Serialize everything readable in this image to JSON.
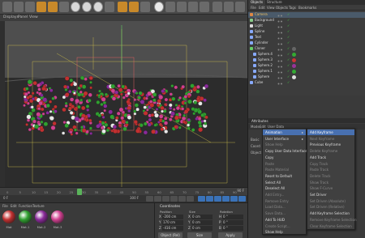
{
  "viewport_menu": [
    "Displays",
    "Panel",
    "View"
  ],
  "objects_panel": {
    "tabs": [
      "Objects",
      "Structure"
    ],
    "menu": [
      "File",
      "Edit",
      "View",
      "Objects",
      "Tags",
      "Bookmarks"
    ],
    "rows": [
      {
        "name": "Camera",
        "color": "#d84"
      },
      {
        "name": "Background",
        "color": "#8c8"
      },
      {
        "name": "Light",
        "color": "#ddd"
      },
      {
        "name": "Spline",
        "color": "#8af"
      },
      {
        "name": "Text",
        "color": "#8af"
      },
      {
        "name": "Cylinder",
        "color": "#8af"
      },
      {
        "name": "Cloner",
        "color": "#6c6"
      },
      {
        "name": "Sphere.4",
        "color": "#8af"
      },
      {
        "name": "Sphere.3",
        "color": "#8af"
      },
      {
        "name": "Sphere.2",
        "color": "#8af"
      },
      {
        "name": "Sphere.1",
        "color": "#8af"
      },
      {
        "name": "Sphere",
        "color": "#8af"
      },
      {
        "name": "Cube",
        "color": "#8af"
      }
    ]
  },
  "attributes_panel": {
    "title": "Attributes",
    "menu": [
      "Mode",
      "Edit",
      "User Data"
    ],
    "rows": [
      "Basic",
      "Coord",
      "Object"
    ]
  },
  "context_menu": {
    "items": [
      {
        "label": "Animation",
        "submenu": true,
        "highlighted": true
      },
      {
        "label": "User Interface",
        "submenu": true
      },
      {
        "label": "Show Help",
        "disabled": true
      },
      {
        "label": "Copy User Data Interface"
      },
      {
        "label": "Copy"
      },
      {
        "label": "Paste",
        "disabled": true
      },
      {
        "label": "Paste Material",
        "disabled": true
      },
      {
        "label": "Reset to Default"
      },
      {
        "label": "Select All"
      },
      {
        "label": "Deselect All"
      },
      {
        "label": "Add Entry...",
        "disabled": true
      },
      {
        "label": "Remove Entry",
        "disabled": true
      },
      {
        "label": "Load Data...",
        "disabled": true
      },
      {
        "label": "Save Data...",
        "disabled": true
      },
      {
        "label": "Add To HUD"
      },
      {
        "label": "Create Script...",
        "disabled": true
      },
      {
        "label": "Show Help"
      }
    ]
  },
  "submenu": {
    "items": [
      {
        "label": "Add Keyframe",
        "highlighted": true
      },
      {
        "label": "Next Keyframe",
        "disabled": true
      },
      {
        "label": "Previous Keyframe"
      },
      {
        "label": "Delete Keyframe",
        "disabled": true
      },
      {
        "label": "Add Track"
      },
      {
        "label": "Copy Track",
        "disabled": true
      },
      {
        "label": "Paste Track",
        "disabled": true
      },
      {
        "label": "Delete Track",
        "disabled": true
      },
      {
        "label": "Show Track",
        "disabled": true
      },
      {
        "label": "Show F-Curve",
        "disabled": true
      },
      {
        "label": "Set Driver"
      },
      {
        "label": "Set Driven (Absolute)",
        "disabled": true
      },
      {
        "label": "Set Driven (Relative)",
        "disabled": true
      },
      {
        "label": "Add Keyframe Selection"
      },
      {
        "label": "Remove Keyframe Selection",
        "disabled": true
      },
      {
        "label": "Clear Keyframe Selection",
        "disabled": true
      }
    ]
  },
  "timeline": {
    "ticks": [
      "0",
      "5",
      "10",
      "15",
      "20",
      "25",
      "30",
      "35",
      "40",
      "45",
      "50",
      "55",
      "60",
      "65",
      "70",
      "75",
      "80",
      "85",
      "90"
    ],
    "end_label": "90 F"
  },
  "frame_field": "300 F",
  "materials": {
    "menu": [
      "File",
      "Edit",
      "Function",
      "Texture"
    ],
    "items": [
      {
        "label": "Mat",
        "color": "#c23030"
      },
      {
        "label": "Mat.1",
        "color": "#30a030"
      },
      {
        "label": "Mat.2",
        "color": "#8a2a9a"
      },
      {
        "label": "Mat.3",
        "color": "#d04090"
      }
    ]
  },
  "coordinates": {
    "title": "Coordinates",
    "headers": [
      "Position",
      "Size",
      "Rotation"
    ],
    "rows": [
      [
        "X",
        "-200 cm",
        "X",
        "0 cm",
        "H",
        "0 °"
      ],
      [
        "Y",
        "170 cm",
        "Y",
        "0 cm",
        "P",
        "0 °"
      ],
      [
        "Z",
        "-416 cm",
        "Z",
        "0 cm",
        "B",
        "0 °"
      ]
    ],
    "mode": "Object (Rel)",
    "size_mode": "Size",
    "apply": "Apply"
  }
}
